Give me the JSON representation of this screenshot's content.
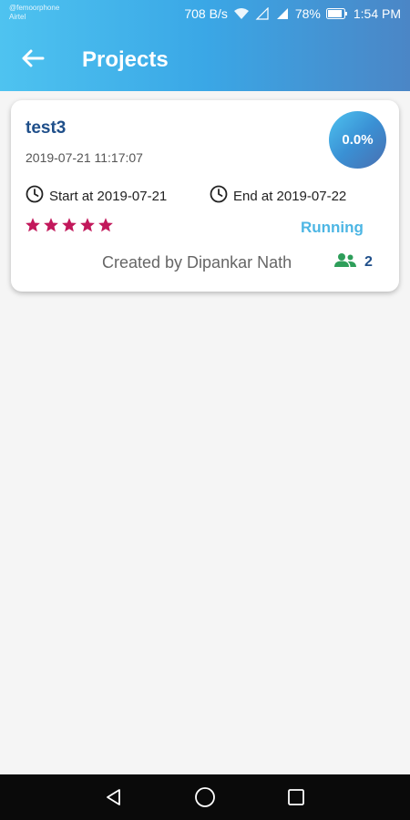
{
  "status_bar": {
    "carrier_line1": "@femoorphone",
    "carrier_line2": "Airtel",
    "speed": "708 B/s",
    "battery": "78%",
    "time": "1:54 PM"
  },
  "appbar": {
    "title": "Projects",
    "back_icon": "arrow-left-icon"
  },
  "project": {
    "name": "test3",
    "created_at": "2019-07-21 11:17:07",
    "progress": "0.0%",
    "start_label": "Start at 2019-07-21",
    "end_label": "End at 2019-07-22",
    "rating": 5,
    "status": "Running",
    "creator": "Created by Dipankar Nath",
    "member_count": "2"
  },
  "colors": {
    "star": "#c2185b",
    "status": "#4db6e4",
    "title": "#1f4f8a",
    "members_icon": "#2e9e5a"
  },
  "navbar": {
    "buttons": [
      "back-triangle-icon",
      "home-circle-icon",
      "recents-square-icon"
    ]
  }
}
